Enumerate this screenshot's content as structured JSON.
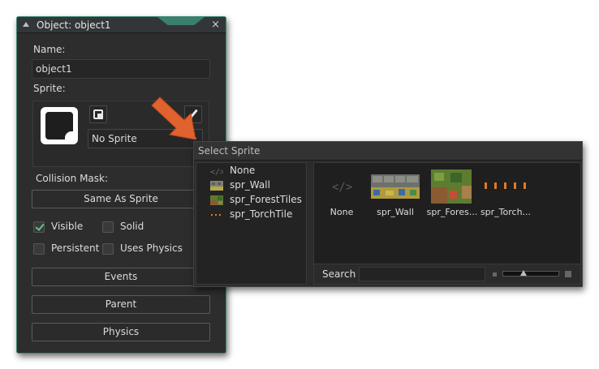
{
  "object_window": {
    "title": "Object: object1",
    "close_glyph": "×",
    "name_label": "Name:",
    "name_value": "object1",
    "sprite_label": "Sprite:",
    "sprite_value": "No Sprite",
    "browse_glyph": "...",
    "collision_label": "Collision Mask:",
    "collision_value": "Same As Sprite",
    "checkboxes": [
      {
        "label": "Visible",
        "checked": true
      },
      {
        "label": "Solid",
        "checked": false
      },
      {
        "label": "Persistent",
        "checked": false
      },
      {
        "label": "Uses Physics",
        "checked": false
      }
    ],
    "buttons": [
      "Events",
      "Parent",
      "Physics"
    ]
  },
  "select_sprite": {
    "title": "Select Sprite",
    "tree": [
      {
        "name": "None",
        "icon": "code-icon"
      },
      {
        "name": "spr_Wall",
        "icon": "wall-thumb-icon"
      },
      {
        "name": "spr_ForestTiles",
        "icon": "forest-thumb-icon"
      },
      {
        "name": "spr_TorchTile",
        "icon": "torch-thumb-icon"
      }
    ],
    "gallery": [
      {
        "caption": "None",
        "icon": "code-icon"
      },
      {
        "caption": "spr_Wall",
        "icon": "wall-thumb-icon"
      },
      {
        "caption": "spr_Fores...",
        "icon": "forest-thumb-icon"
      },
      {
        "caption": "spr_Torch...",
        "icon": "torch-thumb-icon"
      }
    ],
    "search_label": "Search",
    "search_value": ""
  },
  "colors": {
    "accent": "#3c8a75",
    "arrow": "#e0622e",
    "check": "#5fc58e"
  }
}
